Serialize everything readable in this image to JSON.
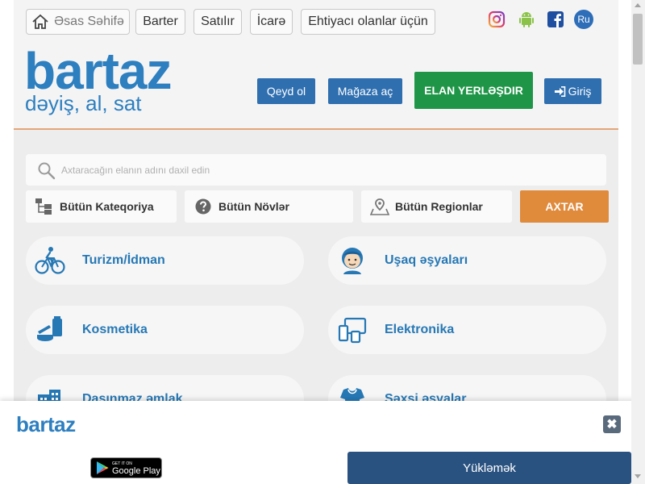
{
  "nav": {
    "home_label": "Əsas Səhifə",
    "barter_label": "Barter",
    "sale_label": "Satılır",
    "rent_label": "İcarə",
    "needy_label": "Ehtiyacı olanlar üçün",
    "lang_label": "Ru",
    "icons": [
      "home-icon",
      "instagram-icon",
      "android-icon",
      "facebook-icon"
    ]
  },
  "header": {
    "logo": "bartaz",
    "tagline": "dəyiş, al, sat",
    "register_label": "Qeyd ol",
    "open_store_label": "Mağaza aç",
    "post_ad_label": "ELAN YERLƏŞDIR",
    "login_label": "Giriş"
  },
  "search": {
    "placeholder": "Axtaracağın elanın adını daxil edin",
    "category_label": "Bütün Kateqoriya",
    "type_label": "Bütün Növlər",
    "region_label": "Bütün Regionlar",
    "button_label": "AXTAR"
  },
  "categories": [
    {
      "label": "Turizm/İdman",
      "icon": "bicycle-icon"
    },
    {
      "label": "Uşaq əşyaları",
      "icon": "child-icon"
    },
    {
      "label": "Kosmetika",
      "icon": "cosmetics-icon"
    },
    {
      "label": "Elektronika",
      "icon": "electronics-icon"
    },
    {
      "label": "Daşınmaz əmlak",
      "icon": "building-icon"
    },
    {
      "label": "Şəxsi əşyalar",
      "icon": "personal-items-icon"
    }
  ],
  "banner": {
    "logo": "bartaz",
    "store_small": "GET IT ON",
    "store_big": "Google Play",
    "download_label": "Yükləmək",
    "close_label": "✖"
  },
  "colors": {
    "brand_blue": "#2d7fc0",
    "button_blue": "#2f6fb0",
    "green": "#1f9547",
    "orange": "#e08a3c",
    "banner_button": "#2a5280"
  }
}
